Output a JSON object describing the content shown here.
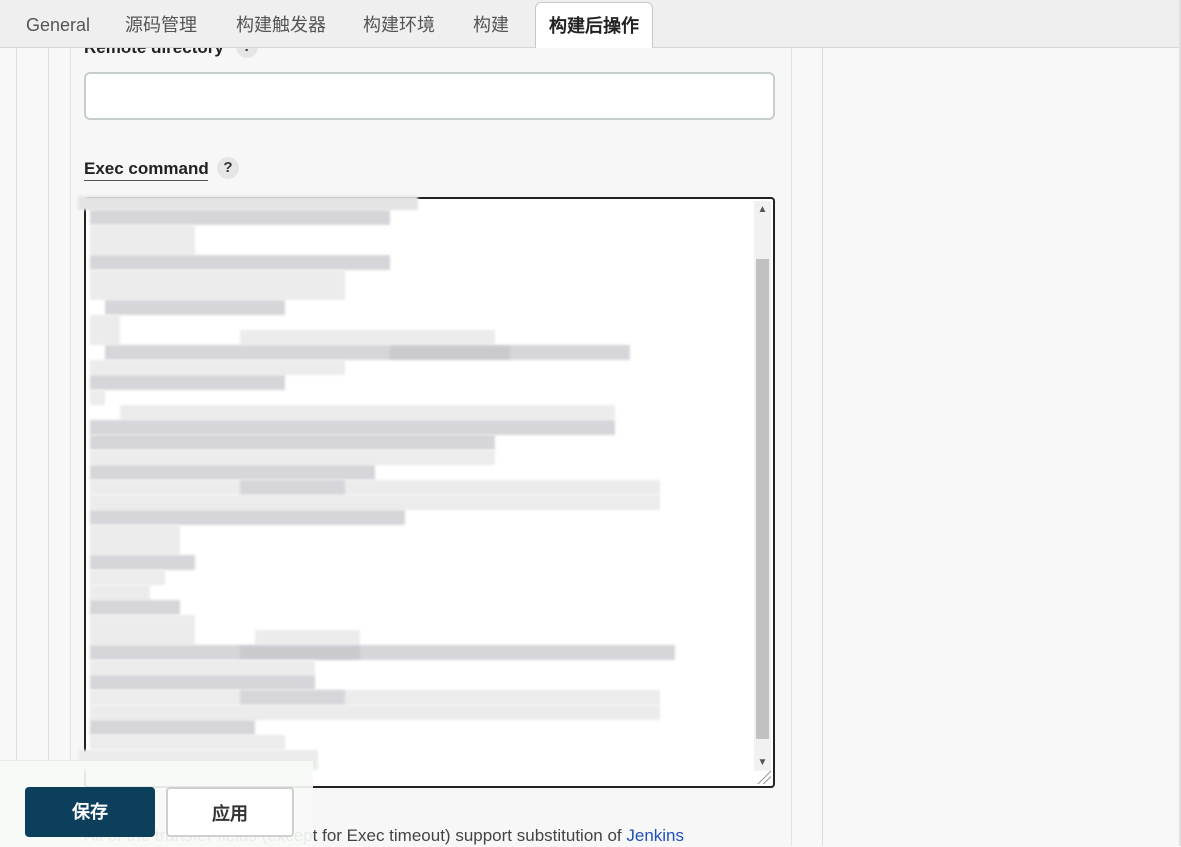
{
  "tabs": [
    {
      "label": "General"
    },
    {
      "label": "源码管理"
    },
    {
      "label": "构建触发器"
    },
    {
      "label": "构建环境"
    },
    {
      "label": "构建"
    },
    {
      "label": "构建后操作"
    }
  ],
  "active_tab": "构建后操作",
  "form": {
    "remote_directory_label": "Remote directory",
    "remote_directory_value": "",
    "exec_command_label": "Exec command",
    "help_symbol": "?",
    "exec_command_value_visible": "(redacted / blurred)"
  },
  "buttons": {
    "save": "保存",
    "apply": "应用"
  },
  "footnote": {
    "text": "All of the transfer fields (except for Exec timeout) support substitution of ",
    "link": "Jenkins"
  },
  "colors": {
    "save_button_bg": "#0b3f5c",
    "link": "#1f4fbf",
    "tab_bar_bg": "#efefef",
    "textarea_border": "#222222"
  }
}
